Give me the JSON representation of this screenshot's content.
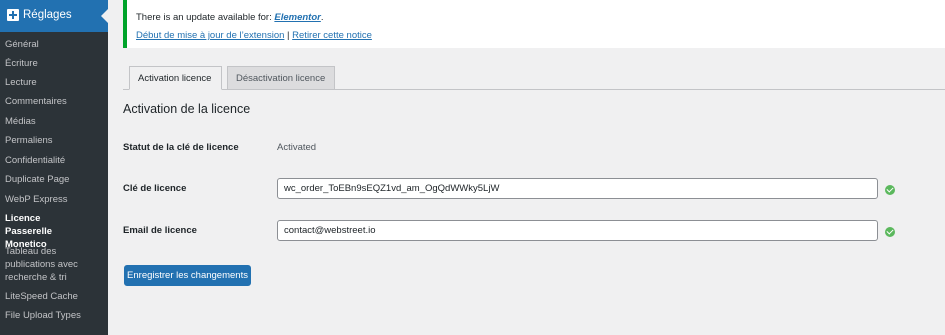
{
  "sidebar": {
    "header": "Réglages",
    "items": [
      {
        "label": "Général"
      },
      {
        "label": "Écriture"
      },
      {
        "label": "Lecture"
      },
      {
        "label": "Commentaires"
      },
      {
        "label": "Médias"
      },
      {
        "label": "Permaliens"
      },
      {
        "label": "Confidentialité"
      },
      {
        "label": "Duplicate Page"
      },
      {
        "label": "WebP Express"
      },
      {
        "label": "Licence Passerelle Monetico"
      },
      {
        "label": "Tableau des publications avec recherche & tri"
      },
      {
        "label": "LiteSpeed Cache"
      },
      {
        "label": "File Upload Types"
      }
    ]
  },
  "notice": {
    "text": "There is an update available for: ",
    "plugin": "Elementor",
    "period": ".",
    "update_link": "Début de mise à jour de l’extension",
    "separator": "|",
    "dismiss_link": "Retirer cette notice"
  },
  "tabs": [
    {
      "label": "Activation licence"
    },
    {
      "label": "Désactivation licence"
    }
  ],
  "section_title": "Activation de la licence",
  "fields": {
    "status_label": "Statut de la clé de licence",
    "status_value": "Activated",
    "key_label": "Clé de licence",
    "key_value": "wc_order_ToEBn9sEQZ1vd_am_OgQdWWky5LjW",
    "email_label": "Email de licence",
    "email_value": "contact@webstreet.io"
  },
  "save_button": "Enregistrer les changements",
  "colors": {
    "accent": "#2271b1",
    "success": "#00a32a",
    "sidebar_bg": "#2c3338"
  }
}
